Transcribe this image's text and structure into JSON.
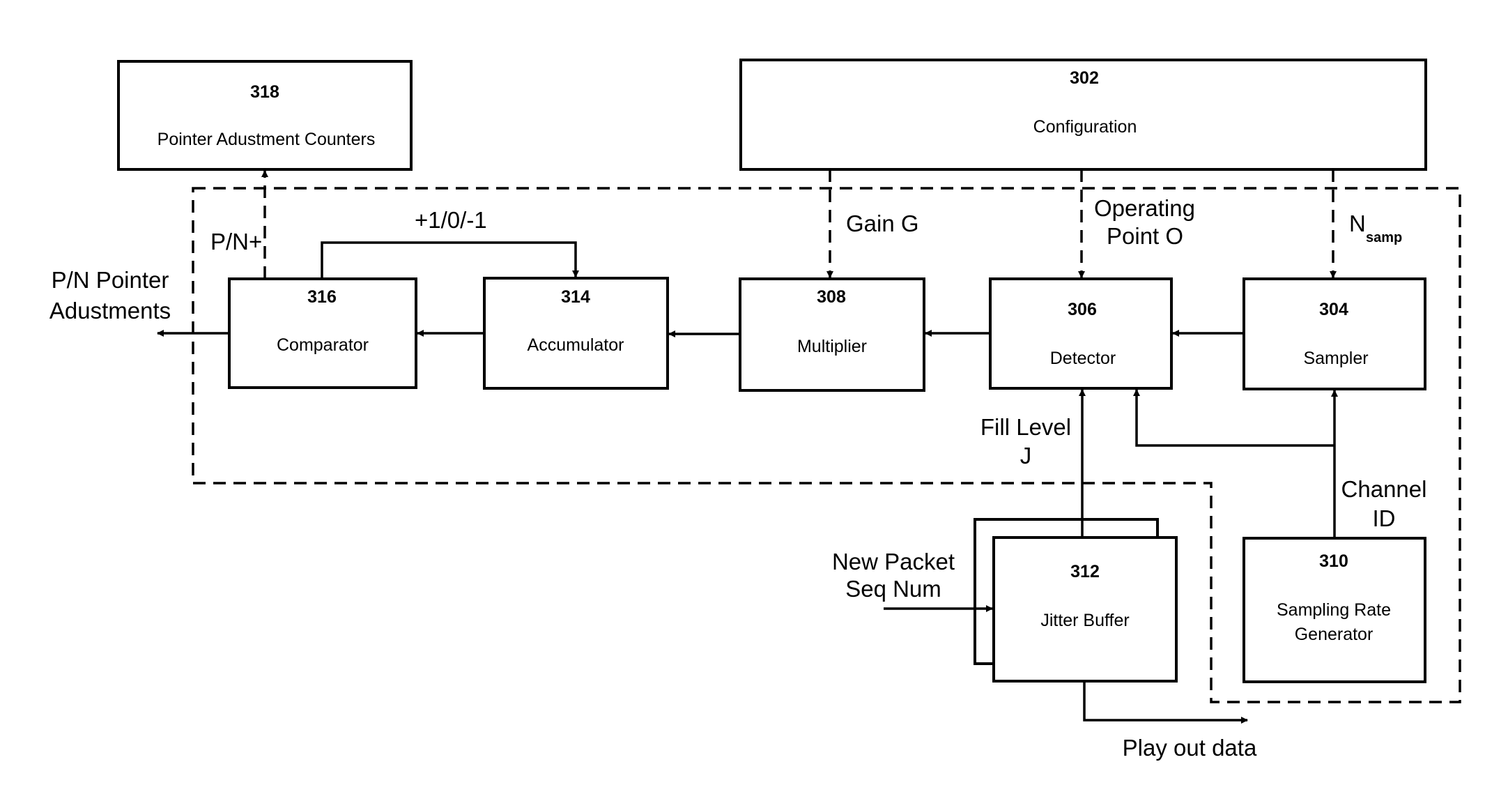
{
  "colors": {
    "stroke": "#000000",
    "background": "#ffffff"
  },
  "blocks": {
    "b318": {
      "number": "318",
      "label": "Pointer Adustment Counters"
    },
    "b302": {
      "number": "302",
      "label": "Configuration"
    },
    "b316": {
      "number": "316",
      "label": "Comparator"
    },
    "b314": {
      "number": "314",
      "label": "Accumulator"
    },
    "b308": {
      "number": "308",
      "label": "Multiplier"
    },
    "b306": {
      "number": "306",
      "label": "Detector"
    },
    "b304": {
      "number": "304",
      "label": "Sampler"
    },
    "b312": {
      "number": "312",
      "label": "Jitter Buffer"
    },
    "b310": {
      "number": "310",
      "label_line1": "Sampling Rate",
      "label_line2": "Generator"
    }
  },
  "signals": {
    "pn_plus": "P/N+",
    "increment": "+1/0/-1",
    "output_line1": "P/N Pointer",
    "output_line2": "Adustments",
    "gain": "Gain G",
    "operating_line1": "Operating",
    "operating_line2": "Point O",
    "nsamp_main": "N",
    "nsamp_sub": "samp",
    "fill_line1": "Fill Level",
    "fill_line2": "J",
    "channel_line1": "Channel",
    "channel_line2": "ID",
    "packet_line1": "New Packet",
    "packet_line2": "Seq Num",
    "playout": "Play out data"
  }
}
